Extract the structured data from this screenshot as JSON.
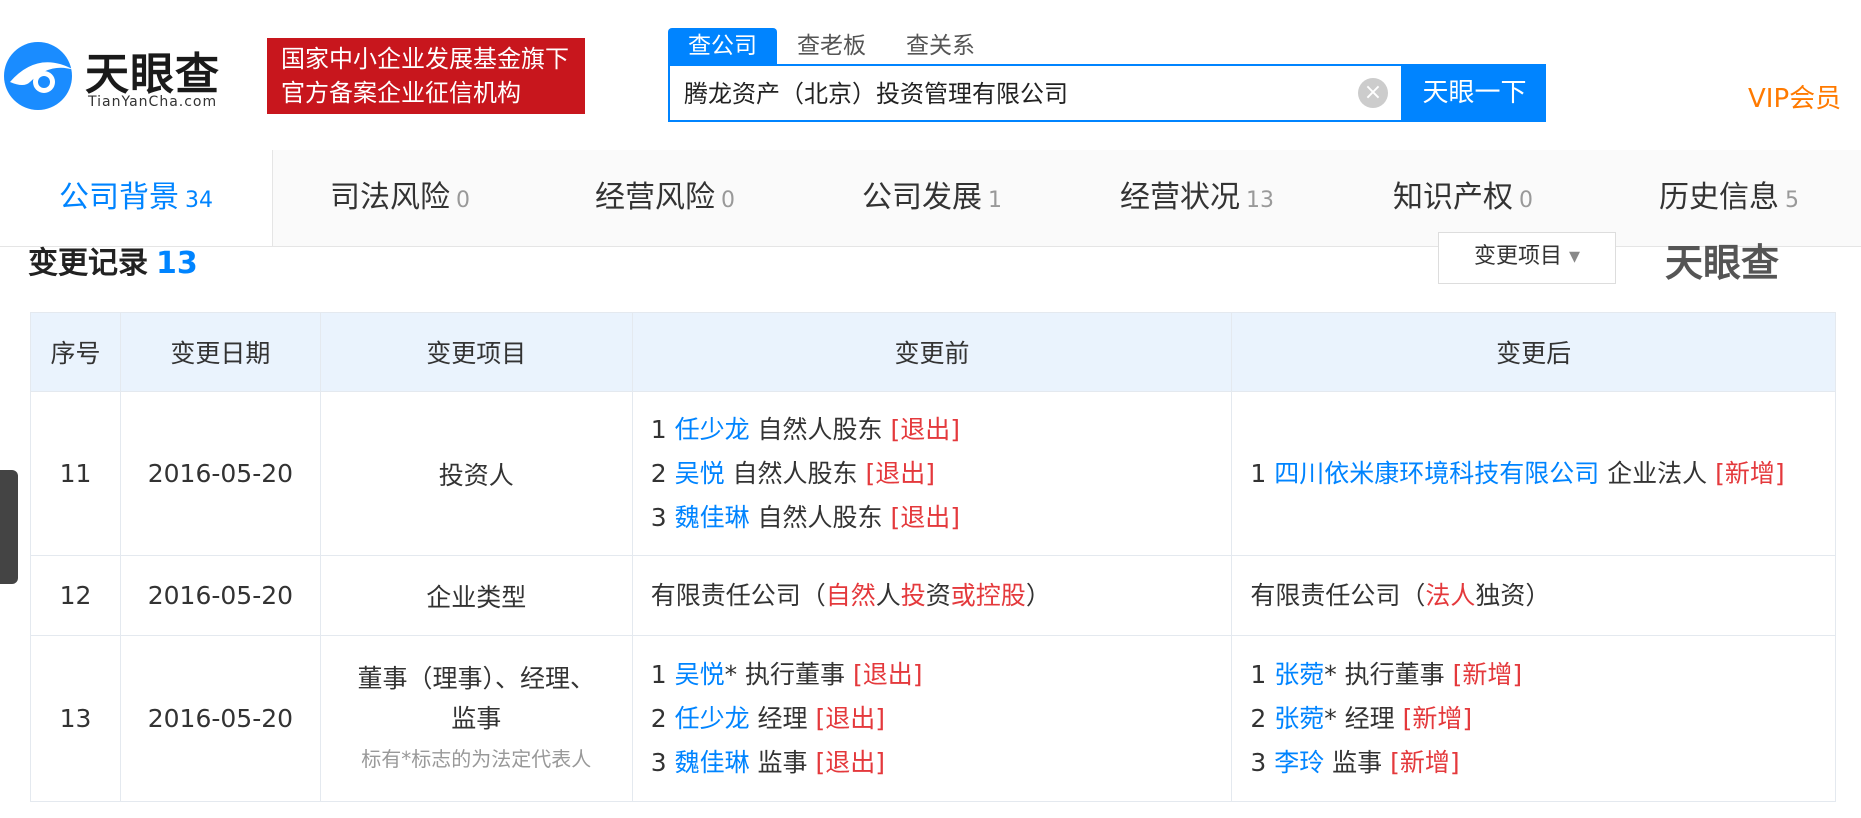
{
  "logo": {
    "cn": "天眼查",
    "en": "TianYanCha.com"
  },
  "badge": {
    "line1": "国家中小企业发展基金旗下",
    "line2": "官方备案企业征信机构"
  },
  "search": {
    "tabs": [
      "查公司",
      "查老板",
      "查关系"
    ],
    "value": "腾龙资产（北京）投资管理有限公司",
    "clear": "×",
    "button": "天眼一下"
  },
  "vip": "VIP会员",
  "nav": [
    {
      "label": "公司背景",
      "count": "34"
    },
    {
      "label": "司法风险",
      "count": "0"
    },
    {
      "label": "经营风险",
      "count": "0"
    },
    {
      "label": "公司发展",
      "count": "1"
    },
    {
      "label": "经营状况",
      "count": "13"
    },
    {
      "label": "知识产权",
      "count": "0"
    },
    {
      "label": "历史信息",
      "count": "5"
    }
  ],
  "section": {
    "title": "变更记录",
    "count": "13"
  },
  "filter": {
    "label": "变更项目",
    "arrow": "▾"
  },
  "watermark": "天眼查",
  "table": {
    "headers": [
      "序号",
      "变更日期",
      "变更项目",
      "变更前",
      "变更后"
    ],
    "rows": [
      {
        "no": "11",
        "date": "2016-05-20",
        "item": "投资人",
        "note": "",
        "before": [
          {
            "idx": "1",
            "name": "任少龙",
            "role": "自然人股东",
            "tag": "[退出]"
          },
          {
            "idx": "2",
            "name": "吴悦",
            "role": "自然人股东",
            "tag": "[退出]"
          },
          {
            "idx": "3",
            "name": "魏佳琳",
            "role": "自然人股东",
            "tag": "[退出]"
          }
        ],
        "after": [
          {
            "idx": "1",
            "name": "四川依米康环境科技有限公司",
            "role": "企业法人",
            "tag": "[新增]"
          }
        ]
      },
      {
        "no": "12",
        "date": "2016-05-20",
        "item": "企业类型",
        "note": "",
        "before_text": {
          "a": "有限责任公司（",
          "b": "自然",
          "c": "人",
          "d": "投",
          "e": "资",
          "f": "或控股",
          "g": "）"
        },
        "after_text": {
          "a": "有限责任公司（",
          "b": "法人",
          "c": "独",
          "d": "资）"
        }
      },
      {
        "no": "13",
        "date": "2016-05-20",
        "item": "董事（理事）、经理、监事",
        "note": "标有*标志的为法定代表人",
        "before": [
          {
            "idx": "1",
            "name": "吴悦",
            "role": "* 执行董事",
            "tag": "[退出]"
          },
          {
            "idx": "2",
            "name": "任少龙",
            "role": "经理",
            "tag": "[退出]"
          },
          {
            "idx": "3",
            "name": "魏佳琳",
            "role": "监事",
            "tag": "[退出]"
          }
        ],
        "after": [
          {
            "idx": "1",
            "name": "张菀",
            "role": "* 执行董事",
            "tag": "[新增]"
          },
          {
            "idx": "2",
            "name": "张菀",
            "role": "* 经理",
            "tag": "[新增]"
          },
          {
            "idx": "3",
            "name": "李玲",
            "role": "监事",
            "tag": "[新增]"
          }
        ]
      }
    ]
  },
  "colors": {
    "brand_blue": "#0084ff",
    "badge_red": "#c8161d",
    "tag_red": "#e4393c",
    "vip_orange": "#ff7a00"
  }
}
